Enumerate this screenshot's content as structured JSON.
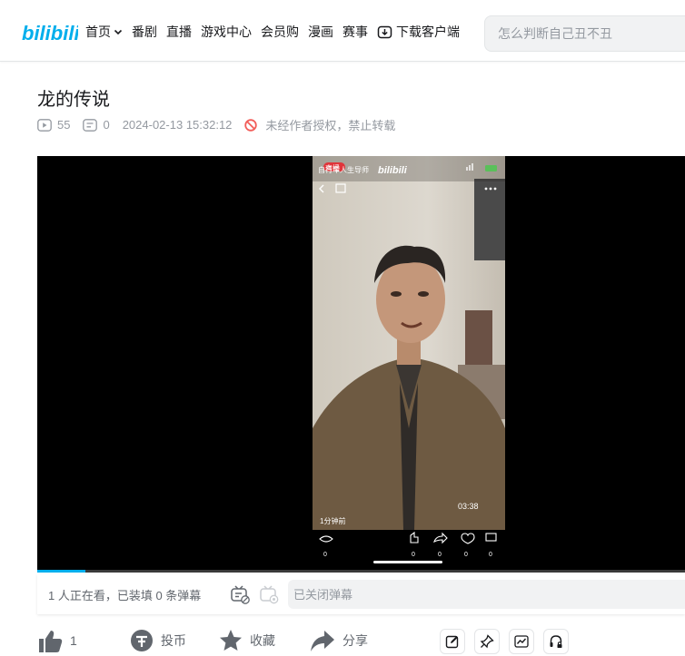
{
  "header": {
    "logo_text": "bilibili",
    "nav": [
      {
        "label": "首页"
      },
      {
        "label": "番剧"
      },
      {
        "label": "直播"
      },
      {
        "label": "游戏中心"
      },
      {
        "label": "会员购"
      },
      {
        "label": "漫画"
      },
      {
        "label": "赛事"
      },
      {
        "label": "下载客户端"
      }
    ],
    "search_placeholder": "怎么判断自己丑不丑"
  },
  "video": {
    "title": "龙的传说",
    "plays": "55",
    "danmaku_count": "0",
    "pubdate": "2024-02-13 15:32:12",
    "copyright_notice": "未经作者授权，禁止转载",
    "progress": 0.075
  },
  "embedded_phone": {
    "status_left": "直播",
    "status_text": "自行车人生导师",
    "watermark": "bilibili",
    "time": "03:38",
    "posted": "1分钟前",
    "stats": [
      "0",
      "0",
      "0",
      "0",
      "0"
    ]
  },
  "danmaku_bar": {
    "viewers_text": "1 人正在看，已装填 0 条弹幕",
    "input_placeholder": "已关闭弹幕"
  },
  "actions": {
    "like": "1",
    "coin": "投币",
    "favorite": "收藏",
    "share": "分享"
  },
  "colors": {
    "brand": "#00aeec",
    "text": "#18191c",
    "muted": "#9499a0",
    "warn": "#f25d59"
  }
}
